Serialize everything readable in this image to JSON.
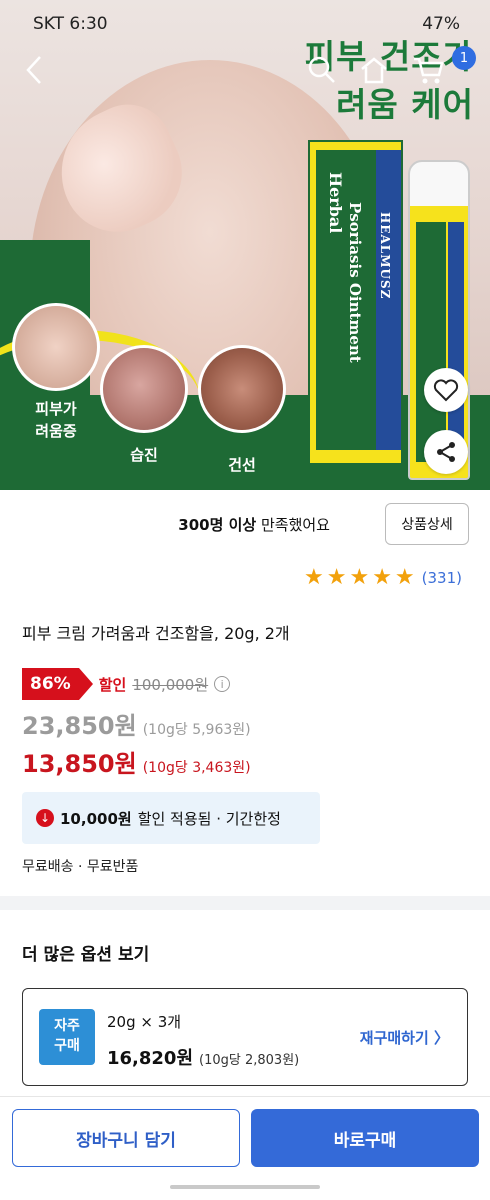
{
  "status_bar": {
    "carrier_time": "SKT 6:30",
    "battery": "47%"
  },
  "hero": {
    "title_line1": "피부 건조가",
    "title_line2": "려움 케어",
    "labels": [
      "피부가",
      "려움증",
      "습진",
      "건선"
    ],
    "package": {
      "brand": "HEALMUSZ",
      "herbal": "Herbal",
      "product": "Psoriasis Ointment"
    }
  },
  "nav": {
    "cart_count": "1"
  },
  "review": {
    "satisfaction_bold": "300명 이상",
    "satisfaction_rest": " 만족했어요",
    "detail_button": "상품상세",
    "stars": 5,
    "count": "(331)"
  },
  "product": {
    "title": "피부 크림 가려움과 건조함을, 20g, 2개",
    "discount_percent": "86%",
    "discount_label": "할인",
    "original_price": "100,000원",
    "price_before": "23,850원",
    "unit_before": "(10g당 5,963원)",
    "price_final": "13,850원",
    "unit_final": "(10g당 3,463원)",
    "coupon_amount": "10,000원",
    "coupon_text": "할인 적용됨 · 기간한정",
    "shipping": "무료배송 · 무료반품"
  },
  "options": {
    "heading": "더 많은 옵션 보기",
    "badge": "자주 구매",
    "quantity": "20g × 3개",
    "price": "16,820원",
    "unit": "(10g당 2,803원)",
    "rebuy": "재구매하기 〉"
  },
  "actions": {
    "cart": "장바구니 담기",
    "buy": "바로구매"
  }
}
